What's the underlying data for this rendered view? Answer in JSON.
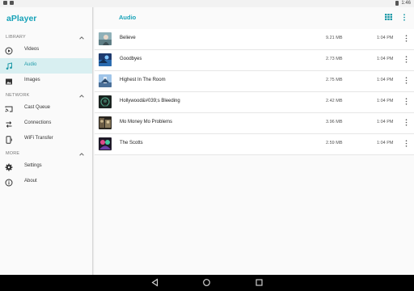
{
  "status_bar": {
    "time": "1:46"
  },
  "app": {
    "title": "aPlayer"
  },
  "sidebar": {
    "sections": [
      {
        "label": "LIBRARY"
      },
      {
        "label": "NETWORK"
      },
      {
        "label": "MORE"
      }
    ],
    "items": [
      {
        "label": "Videos",
        "icon": "play-circle-icon"
      },
      {
        "label": "Audio",
        "icon": "music-note-icon",
        "active": true
      },
      {
        "label": "Images",
        "icon": "image-icon"
      },
      {
        "label": "Cast Queue",
        "icon": "cast-icon"
      },
      {
        "label": "Connections",
        "icon": "connections-icon"
      },
      {
        "label": "WiFi Transfer",
        "icon": "phone-transfer-icon"
      },
      {
        "label": "Settings",
        "icon": "gear-icon"
      },
      {
        "label": "About",
        "icon": "info-icon"
      }
    ]
  },
  "main": {
    "title": "Audio",
    "rows": [
      {
        "title": "Believe",
        "size": "9.21 MB",
        "time": "1:04 PM"
      },
      {
        "title": "Goodbyes",
        "size": "2.73 MB",
        "time": "1:04 PM"
      },
      {
        "title": "Highest In The Room",
        "size": "2.75 MB",
        "time": "1:04 PM"
      },
      {
        "title": "Hollywood&#039;s Bleeding",
        "size": "2.42 MB",
        "time": "1:04 PM"
      },
      {
        "title": "Mo Money Mo Problems",
        "size": "3.96 MB",
        "time": "1:04 PM"
      },
      {
        "title": "The Scotts",
        "size": "2.59 MB",
        "time": "1:04 PM"
      }
    ]
  },
  "colors": {
    "accent": "#17a2b8",
    "active_bg": "#d8eff1"
  }
}
